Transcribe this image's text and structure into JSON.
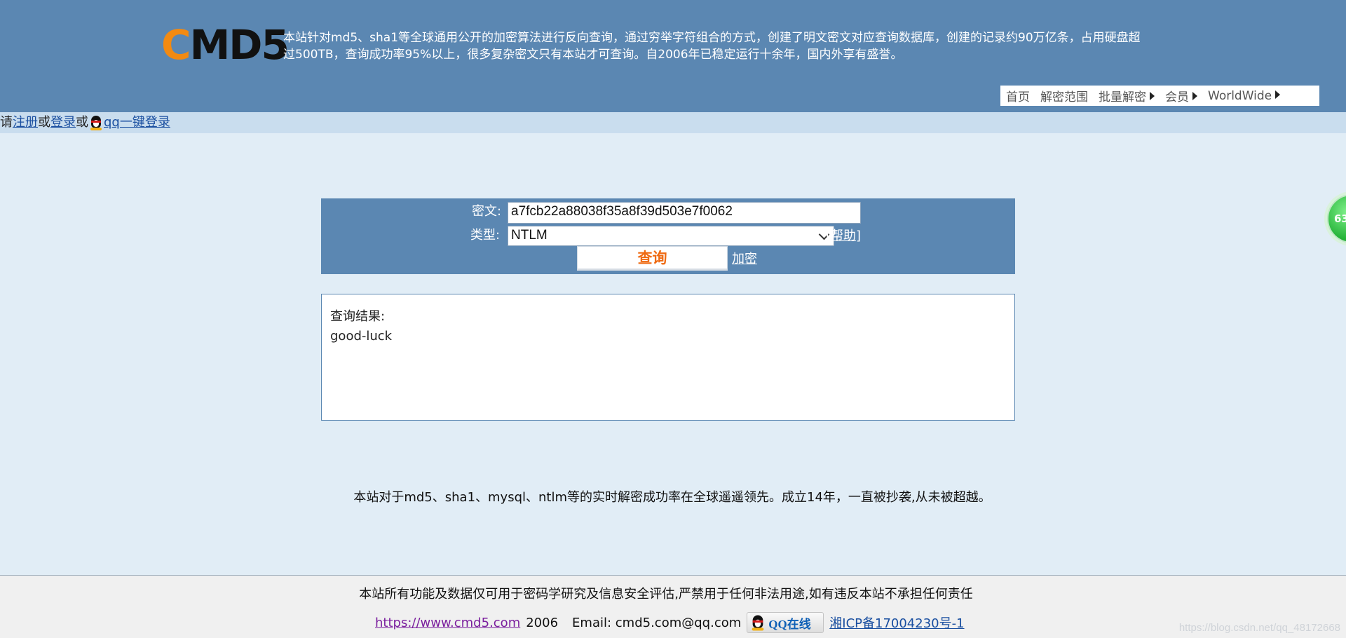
{
  "header": {
    "logo_c": "C",
    "logo_rest": "MD5",
    "intro_line1": "本站针对md5、sha1等全球通用公开的加密算法进行反向查询，通过穷举字符组合的方式，创建了明文密文对应查询数据库，创建的记录约90万亿条，占用硬盘超",
    "intro_line2": "过500TB，查询成功率95%以上，很多复杂密文只有本站才可查询。自2006年已稳定运行十余年，国内外享有盛誉。",
    "nav": {
      "home": "首页",
      "scope": "解密范围",
      "batch": "批量解密",
      "member": "会员",
      "worldwide": "WorldWide"
    }
  },
  "loginbar": {
    "prefix": "请",
    "register": "注册",
    "or1": "或",
    "login": "登录",
    "or2": "或",
    "qq_login": "qq一键登录"
  },
  "query": {
    "cipher_label": "密文:",
    "cipher_value": "a7fcb22a88038f35a8f39d503e7f0062",
    "type_label": "类型:",
    "type_value": "NTLM",
    "help": "[帮助]",
    "submit": "查询",
    "encrypt": "加密"
  },
  "result": {
    "label": "查询结果:",
    "value": "good-luck"
  },
  "notice": "本站对于md5、sha1、mysql、ntlm等的实时解密成功率在全球遥遥领先。成立14年，一直被抄袭,从未被超越。",
  "footer": {
    "disclaimer": "本站所有功能及数据仅可用于密码学研究及信息安全评估,严禁用于任何非法用途,如有违反本站不承担任何责任",
    "site": "https://www.cmd5.com",
    "year": "2006",
    "email": "Email: cmd5.com@qq.com",
    "qq_online": "QQ在线",
    "icp": "湘ICP备17004230号-1",
    "watermark": "https://blog.csdn.net/qq_48172668"
  },
  "float_badge": "63",
  "colors": {
    "header_bg": "#5b87b2",
    "page_bg": "#e1edf6",
    "logo_accent": "#f28a12",
    "query_button_text": "#ef6a12"
  }
}
